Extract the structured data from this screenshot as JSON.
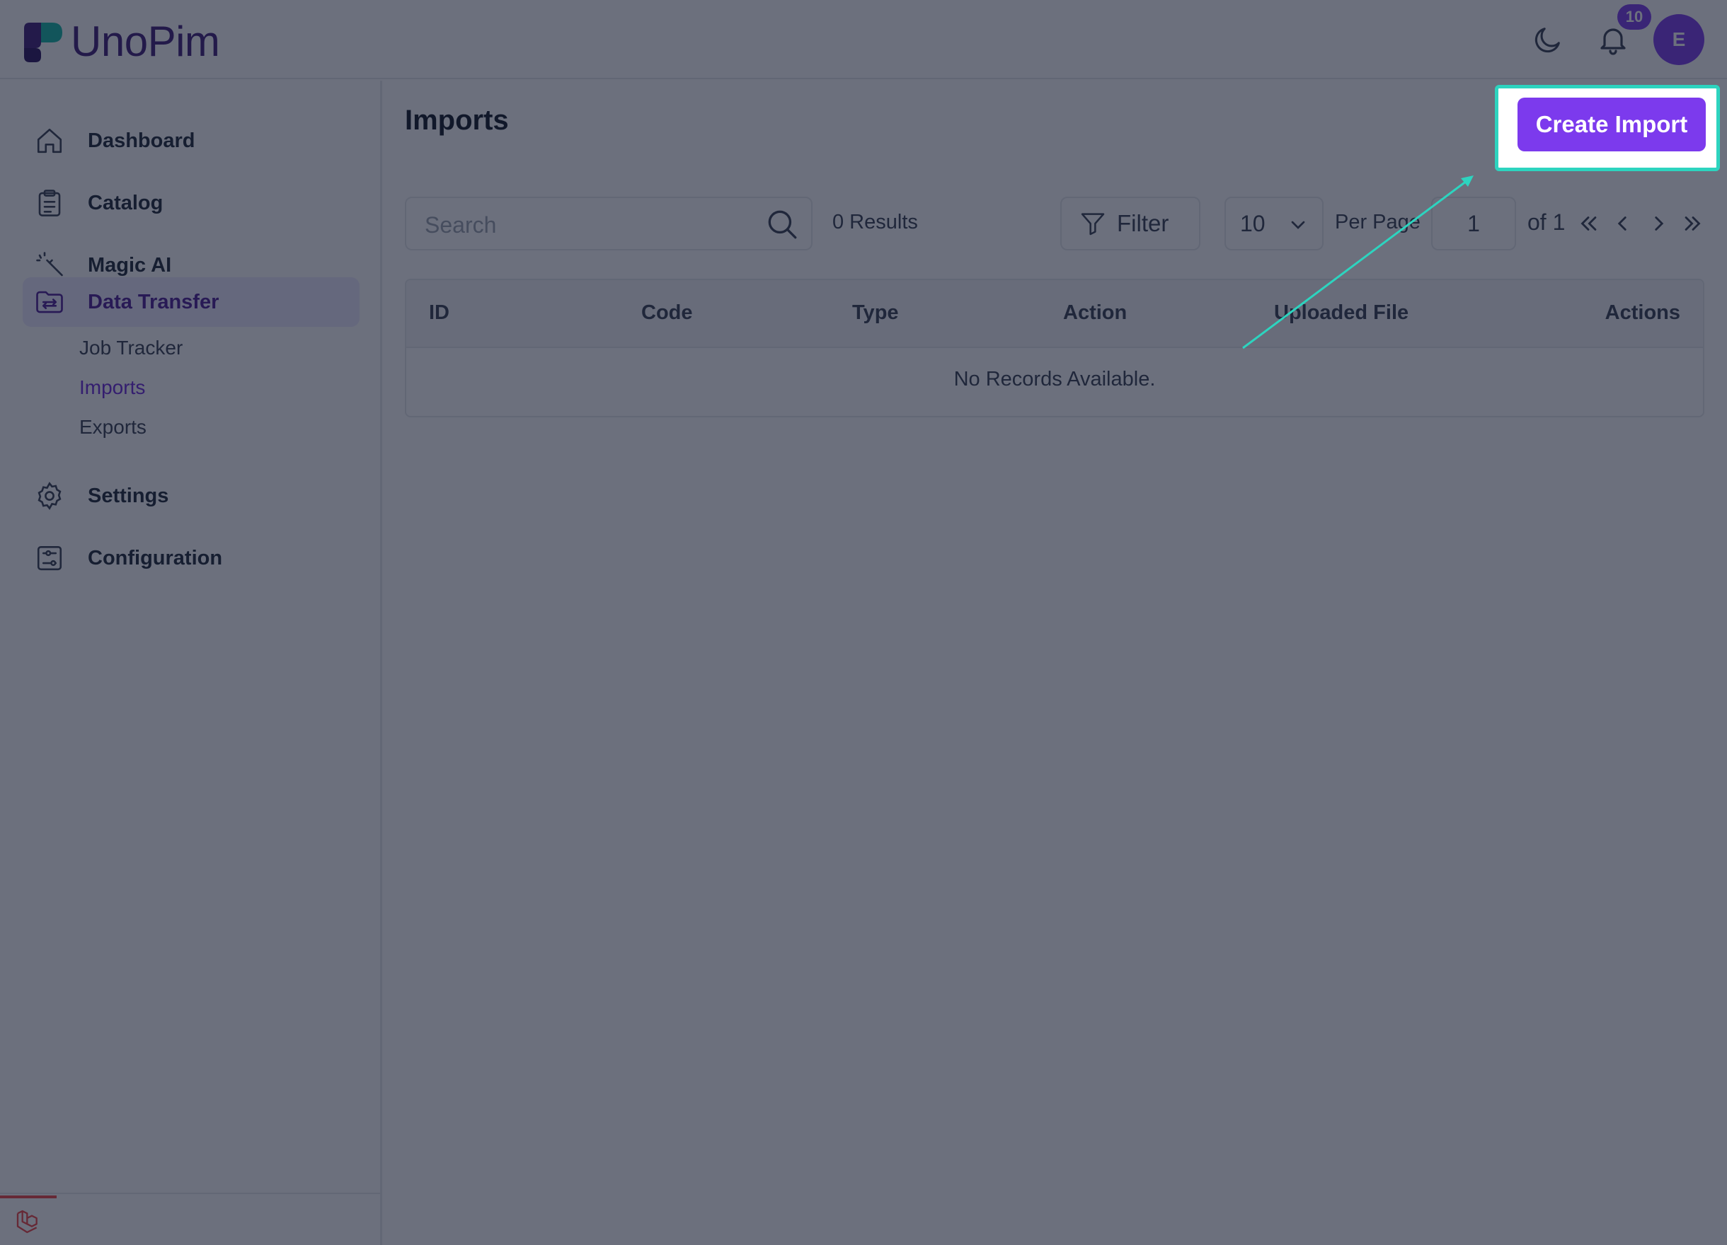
{
  "app": {
    "name": "UnoPim"
  },
  "header": {
    "notification_count": "10",
    "avatar_initial": "E",
    "icons": [
      "moon-icon",
      "bell-icon"
    ]
  },
  "sidebar": {
    "items": [
      {
        "label": "Dashboard",
        "icon": "home-icon"
      },
      {
        "label": "Catalog",
        "icon": "clipboard-icon"
      },
      {
        "label": "Magic AI",
        "icon": "magic-wand-icon"
      },
      {
        "label": "Data Transfer",
        "icon": "folder-transfer-icon",
        "active": true,
        "children": [
          {
            "label": "Job Tracker"
          },
          {
            "label": "Imports",
            "active": true
          },
          {
            "label": "Exports"
          }
        ]
      },
      {
        "label": "Settings",
        "icon": "gear-icon"
      },
      {
        "label": "Configuration",
        "icon": "sliders-icon"
      }
    ]
  },
  "main": {
    "title": "Imports",
    "create_button": "Create Import",
    "search_placeholder": "Search",
    "results_text": "0 Results",
    "filter_label": "Filter",
    "per_page_value": "10",
    "per_page_label": "Per Page",
    "current_page": "1",
    "of_total": "of 1",
    "table": {
      "columns": [
        "ID",
        "Code",
        "Type",
        "Action",
        "Uploaded File",
        "Actions"
      ],
      "empty_text": "No Records Available."
    }
  },
  "colors": {
    "brand": "#7c3aed",
    "highlight": "#2dd4bf",
    "logo_text": "#3f1d7a"
  }
}
